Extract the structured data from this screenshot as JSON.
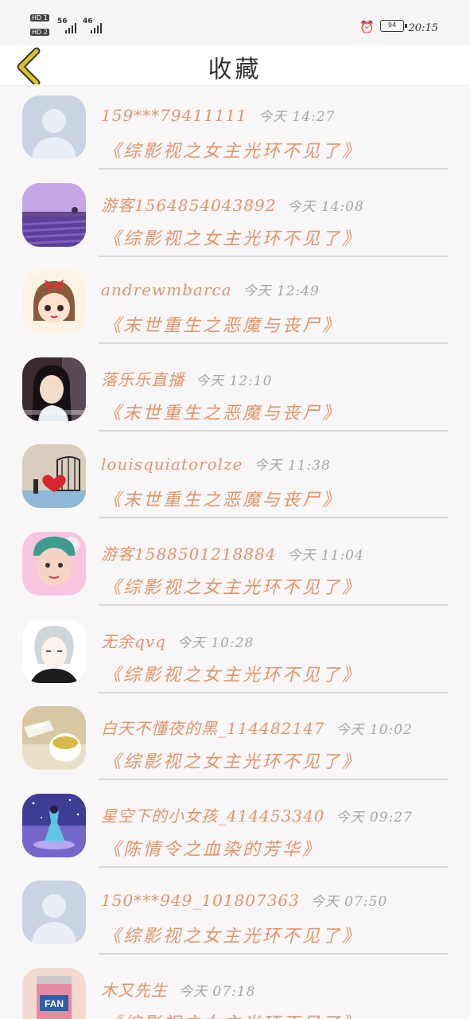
{
  "status_bar": {
    "sim1": "HD 1",
    "sim2": "HD 2",
    "net1": "56",
    "net2": "46",
    "battery": "94",
    "time": "20:15",
    "alarm_icon": "alarm-clock-icon"
  },
  "header": {
    "title": "收藏",
    "back_icon": "chevron-left-icon",
    "accent": "#e0c21a"
  },
  "colors": {
    "name": "#e0956a",
    "time": "#a6a6a6",
    "divider": "#d9d9d9"
  },
  "favorites": [
    {
      "user": "159***79411111",
      "time": "今天 14:27",
      "book": "《综影视之女主光环不见了》",
      "avatar": "default-avatar"
    },
    {
      "user": "游客1564854043892",
      "time": "今天 14:08",
      "book": "《综影视之女主光环不见了》",
      "avatar": "lavender-field"
    },
    {
      "user": "andrewmbarca",
      "time": "今天 12:49",
      "book": "《末世重生之恶魔与丧尸》",
      "avatar": "cartoon-girl"
    },
    {
      "user": "落乐乐直播",
      "time": "今天 12:10",
      "book": "《末世重生之恶魔与丧尸》",
      "avatar": "selfie-girl"
    },
    {
      "user": "louisquiatorolze",
      "time": "今天 11:38",
      "book": "《末世重生之恶魔与丧尸》",
      "avatar": "birdcage-heart"
    },
    {
      "user": "游客1588501218884",
      "time": "今天 11:04",
      "book": "《综影视之女主光环不见了》",
      "avatar": "child-pink"
    },
    {
      "user": "无余qvq",
      "time": "今天 10:28",
      "book": "《综影视之女主光环不见了》",
      "avatar": "anime-boy"
    },
    {
      "user": "白天不懂夜的黑_114482147",
      "time": "今天 10:02",
      "book": "《综影视之女主光环不见了》",
      "avatar": "tea-cup"
    },
    {
      "user": "星空下的小女孩_414453340",
      "time": "今天 09:27",
      "book": "《陈情令之血染的芳华》",
      "avatar": "starry-girl"
    },
    {
      "user": "150***949_101807363",
      "time": "今天 07:50",
      "book": "《综影视之女主光环不见了》",
      "avatar": "default-avatar"
    },
    {
      "user": "木又先生",
      "time": "今天 07:18",
      "book": "《综影视之女主光环不见了》",
      "avatar": "fanta-can"
    }
  ]
}
